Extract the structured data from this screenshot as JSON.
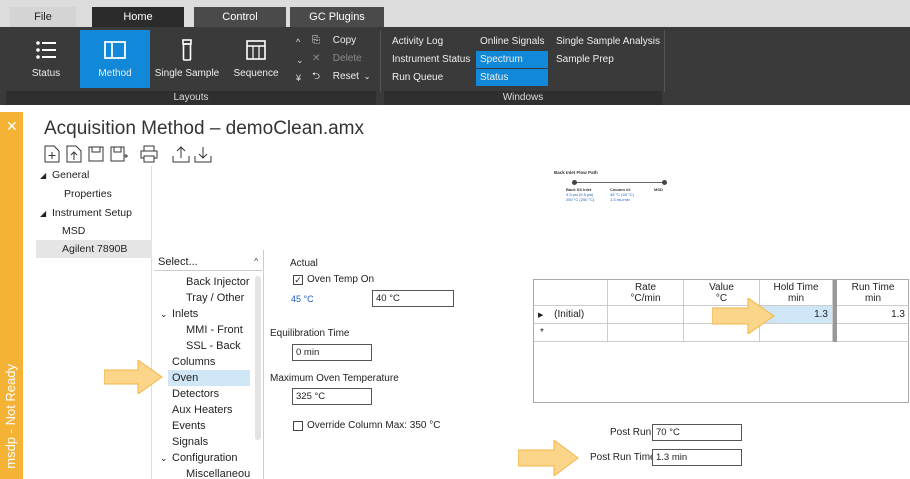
{
  "tabs": {
    "file": "File",
    "home": "Home",
    "control": "Control",
    "gc_plugins": "GC Plugins"
  },
  "ribbon": {
    "layouts": {
      "label": "Layouts",
      "buttons": {
        "status": "Status",
        "method": "Method",
        "single_sample": "Single Sample",
        "sequence": "Sequence"
      }
    },
    "edit": {
      "copy": "Copy",
      "delete": "Delete",
      "reset": "Reset"
    },
    "windows": {
      "label": "Windows",
      "activity_log": "Activity Log",
      "instrument_status": "Instrument Status",
      "run_queue": "Run Queue",
      "online_signals": "Online Signals",
      "spectrum": "Spectrum",
      "status": "Status",
      "single_sample_analysis": "Single Sample Analysis",
      "sample_prep": "Sample Prep"
    }
  },
  "status_strip": {
    "text": "msdp - Not Ready"
  },
  "page_title": "Acquisition Method – demoClean.amx",
  "tree": {
    "general": "General",
    "properties": "Properties",
    "instrument_setup": "Instrument Setup",
    "msd": "MSD",
    "agilent": "Agilent 7890B"
  },
  "flow": {
    "title": "Back Inlet Flow Path",
    "inlet": "Back SS Inlet",
    "inlet_line2": "9.5 psi (9.5 psi)",
    "inlet_line3": "250 °C (250 °C)",
    "column": "Column #2",
    "column_line2": "45 °C (45 °C)",
    "column_line3": "1.3 mL/min",
    "msd": "MSD"
  },
  "select_list": {
    "header": "Select...",
    "items": [
      "Back Injector",
      "Tray / Other",
      "Inlets",
      "MMI - Front",
      "SSL - Back",
      "Columns",
      "Oven",
      "Detectors",
      "Aux Heaters",
      "Events",
      "Signals",
      "Configuration",
      "Miscellaneou"
    ]
  },
  "oven": {
    "actual_label": "Actual",
    "oven_temp_on": "Oven Temp On",
    "actual_temp": "45 °C",
    "setpoint": "40 °C",
    "equilibration_label": "Equilibration Time",
    "equilibration_value": "0 min",
    "max_temp_label": "Maximum Oven Temperature",
    "max_temp_value": "325 °C",
    "override_label": "Override Column Max: 350 °C",
    "post_run_label": "Post Run:",
    "post_run_value": "70 °C",
    "post_run_time_label": "Post Run Time:",
    "post_run_time_value": "1.3 min"
  },
  "ramp_table": {
    "headers": {
      "rate": "Rate",
      "rate_unit": "°C/min",
      "value": "Value",
      "value_unit": "°C",
      "hold": "Hold Time",
      "hold_unit": "min",
      "run": "Run Time",
      "run_unit": "min"
    },
    "row_label": "(Initial)",
    "hold_value": "1.3",
    "run_value": "1.3",
    "row_marker": "▶",
    "new_row_marker": "*"
  },
  "colors": {
    "accent": "#1289d8",
    "status_strip": "#f5b335",
    "arrow": "#fbd58a",
    "ribbon": "#3a3a3a"
  }
}
